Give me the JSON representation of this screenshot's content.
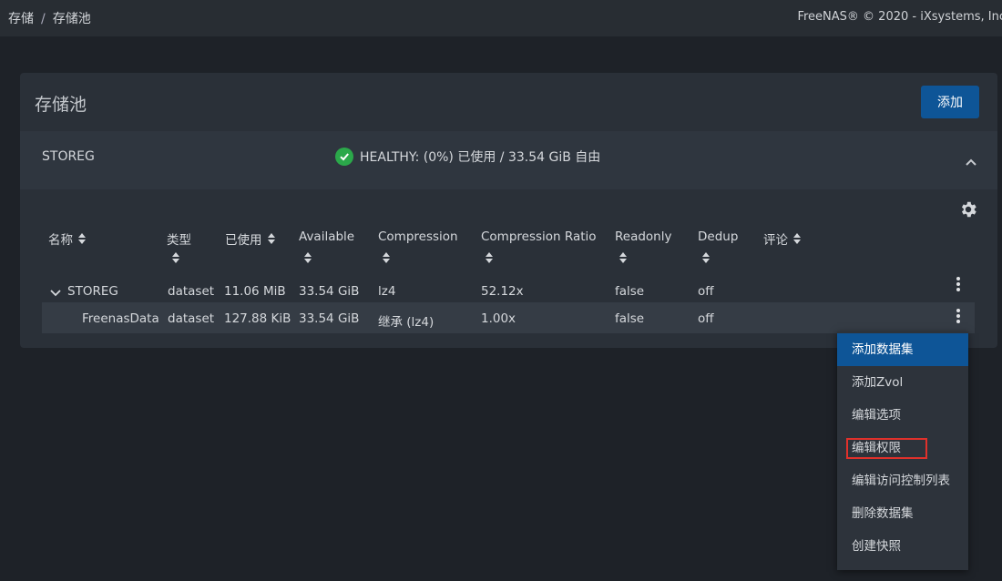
{
  "breadcrumb": {
    "item1": "存储",
    "separator": "/",
    "item2": "存储池"
  },
  "copyright": "FreeNAS® © 2020 - iXsystems, Inc",
  "card": {
    "title": "存储池",
    "add_label": "添加"
  },
  "pool": {
    "name": "STOREG",
    "status_text": "HEALTHY: (0%) 已使用 / 33.54 GiB 自由",
    "status_icon": "check-circle-icon",
    "status_color": "#2ba84a"
  },
  "table": {
    "columns": [
      "名称",
      "类型",
      "已使用",
      "Available",
      "Compression",
      "Compression Ratio",
      "Readonly",
      "Dedup",
      "评论"
    ],
    "rows": [
      [
        "STOREG",
        "dataset",
        "11.06 MiB",
        "33.54 GiB",
        "lz4",
        "52.12x",
        "false",
        "off"
      ],
      [
        "FreenasData",
        "dataset",
        "127.88 KiB",
        "33.54 GiB",
        "继承 (lz4)",
        "1.00x",
        "false",
        "off"
      ]
    ]
  },
  "menu": {
    "items": [
      "添加数据集",
      "添加Zvol",
      "编辑选项",
      "编辑权限",
      "编辑访问控制列表",
      "删除数据集",
      "创建快照"
    ],
    "active_item": "添加数据集",
    "highlighted_item": "编辑权限",
    "highlight_color": "#e0312b"
  },
  "colors": {
    "accent": "#0e5597",
    "background": "#1e2228",
    "card": "#2a3038"
  }
}
